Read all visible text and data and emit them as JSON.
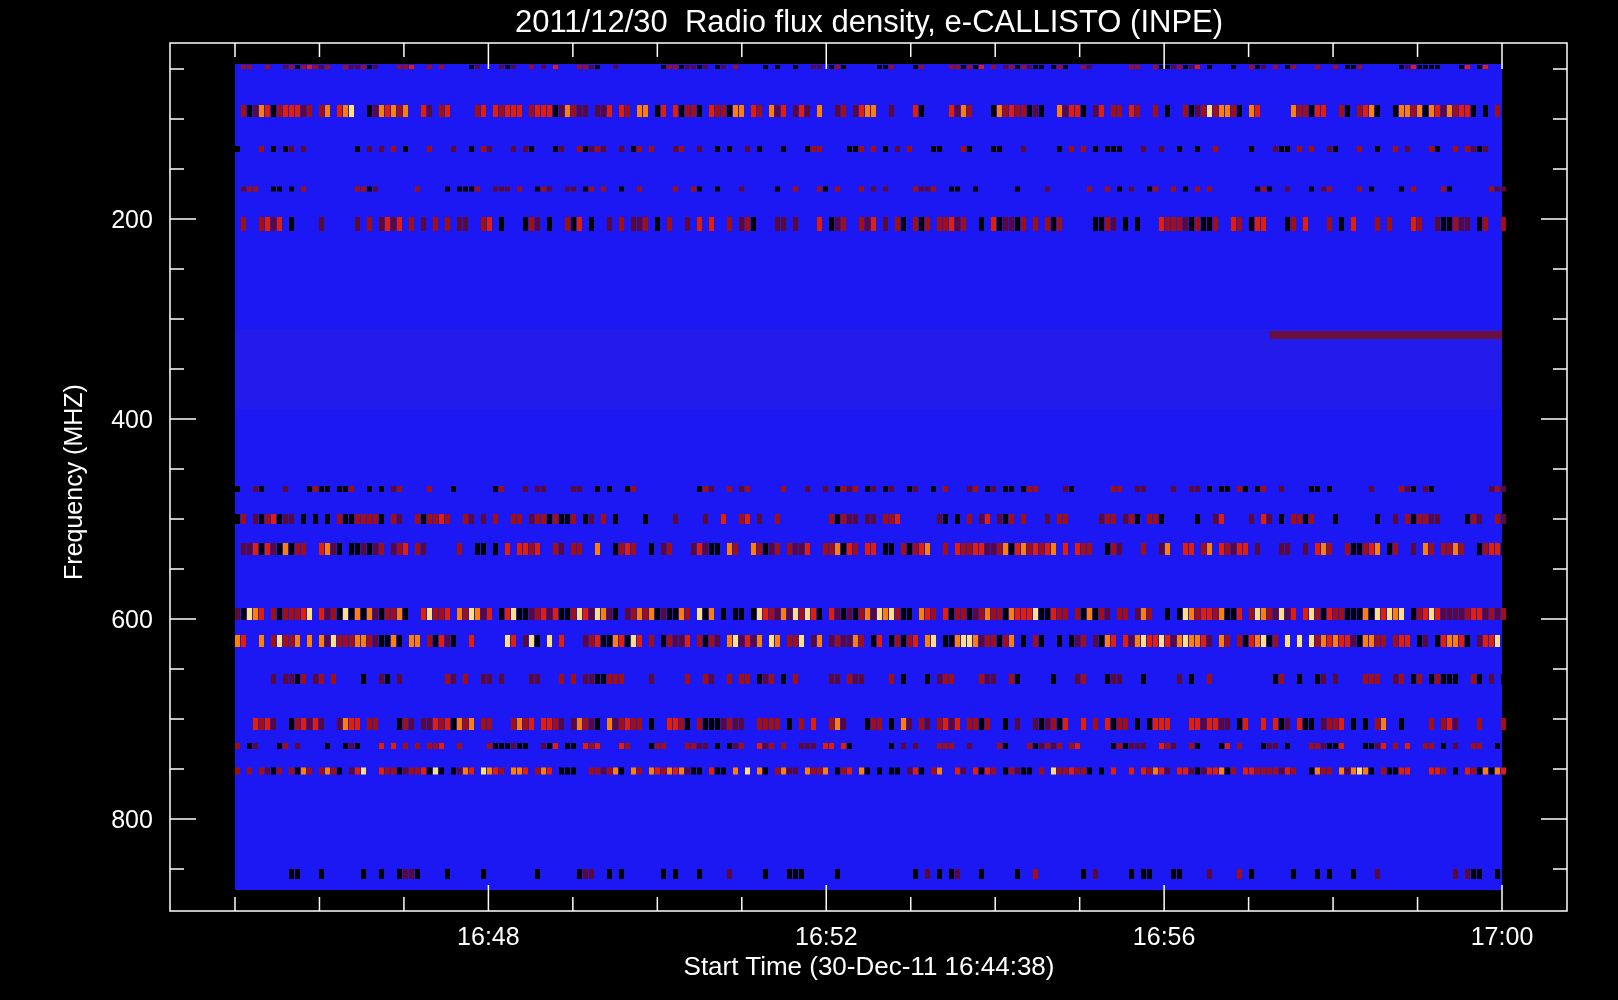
{
  "title": "2011/12/30  Radio flux density, e-CALLISTO (INPE)",
  "y_axis": {
    "label": "Frequency (MHZ)",
    "ticks": [
      "200",
      "400",
      "600",
      "800"
    ]
  },
  "x_axis": {
    "label": "Start Time (30-Dec-11 16:44:38)",
    "ticks": [
      "16:48",
      "16:52",
      "16:56",
      "17:00"
    ]
  }
}
